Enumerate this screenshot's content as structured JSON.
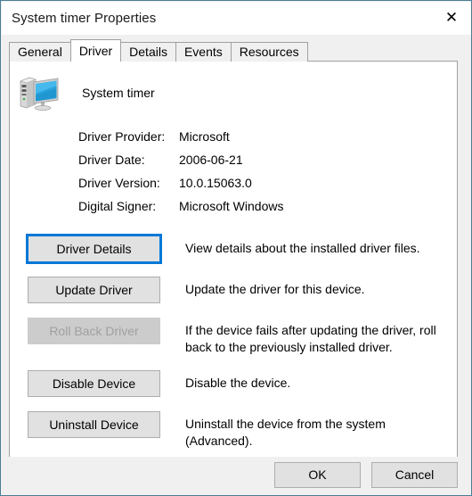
{
  "window": {
    "title": "System timer Properties",
    "close_label": "✕",
    "border_color": "#4a7e92"
  },
  "tabs": [
    {
      "label": "General",
      "selected": false
    },
    {
      "label": "Driver",
      "selected": true
    },
    {
      "label": "Details",
      "selected": false
    },
    {
      "label": "Events",
      "selected": false
    },
    {
      "label": "Resources",
      "selected": false
    }
  ],
  "device": {
    "name": "System timer",
    "icon": "computer-icon"
  },
  "driver_info": [
    {
      "label": "Driver Provider:",
      "value": "Microsoft"
    },
    {
      "label": "Driver Date:",
      "value": "2006-06-21"
    },
    {
      "label": "Driver Version:",
      "value": "10.0.15063.0"
    },
    {
      "label": "Digital Signer:",
      "value": "Microsoft Windows"
    }
  ],
  "actions": [
    {
      "button": "Driver Details",
      "description": "View details about the installed driver files.",
      "disabled": false,
      "focused": true
    },
    {
      "button": "Update Driver",
      "description": "Update the driver for this device.",
      "disabled": false,
      "focused": false
    },
    {
      "button": "Roll Back Driver",
      "description": "If the device fails after updating the driver, roll back to the previously installed driver.",
      "disabled": true,
      "focused": false
    },
    {
      "button": "Disable Device",
      "description": "Disable the device.",
      "disabled": false,
      "focused": false
    },
    {
      "button": "Uninstall Device",
      "description": "Uninstall the device from the system (Advanced).",
      "disabled": false,
      "focused": false
    }
  ],
  "footer": {
    "ok_label": "OK",
    "cancel_label": "Cancel"
  },
  "colors": {
    "accent": "#0078d7",
    "dialog_background": "#f0f0f0",
    "panel_background": "#ffffff",
    "button_face": "#e1e1e1",
    "disabled_face": "#cccccc",
    "disabled_text": "#a0a0a0"
  }
}
